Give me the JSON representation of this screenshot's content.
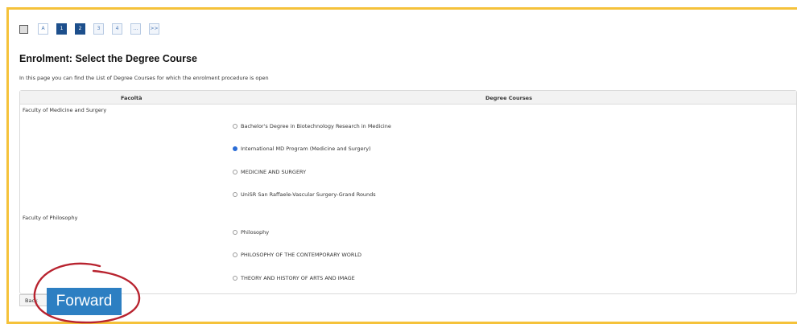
{
  "pager": {
    "items": [
      "A",
      "1",
      "2",
      "3",
      "4",
      "...",
      ">>"
    ]
  },
  "page": {
    "title": "Enrolment: Select the Degree Course",
    "description": "In this page you can find the List of Degree Courses for which the enrolment procedure is open"
  },
  "table": {
    "headers": [
      "Facoltà",
      "Degree Courses"
    ],
    "faculties": [
      {
        "name": "Faculty of Medicine and Surgery",
        "courses": [
          "Bachelor's Degree in Biotechnology Research in Medicine",
          "International MD Program (Medicine and Surgery)",
          "MEDICINE AND SURGERY",
          "UniSR San Raffaele-Vascular Surgery-Grand Rounds"
        ]
      },
      {
        "name": "Faculty of Philosophy",
        "courses": [
          "Philosophy",
          "PHILOSOPHY OF THE CONTEMPORARY WORLD",
          "THEORY AND HISTORY OF ARTS AND IMAGE"
        ]
      }
    ],
    "selected_course": "International MD Program (Medicine and Surgery)"
  },
  "buttons": {
    "back": "Back",
    "forward": "Forward"
  },
  "colors": {
    "frame_border": "#f5c23a",
    "forward_bg": "#2d7fc2",
    "annotation_circle": "#b8232f",
    "active_page": "#1d4f8c"
  }
}
